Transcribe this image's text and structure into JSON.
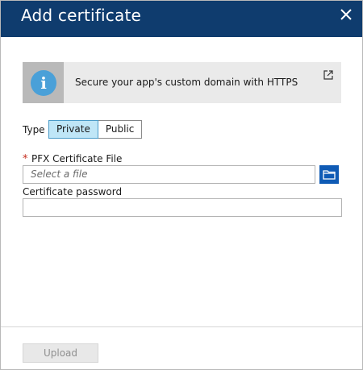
{
  "dialog": {
    "title": "Add certificate",
    "close_icon": "close-icon"
  },
  "banner": {
    "icon": "info-icon",
    "icon_glyph": "i",
    "message": "Secure your app's custom domain with HTTPS",
    "link_icon": "external-link-icon"
  },
  "type_selector": {
    "label": "Type",
    "options": [
      "Private",
      "Public"
    ],
    "selected": "Private"
  },
  "pfx_field": {
    "required_marker": "*",
    "label": "PFX Certificate File",
    "placeholder": "Select a file",
    "browse_icon": "folder-icon"
  },
  "password_field": {
    "label": "Certificate password",
    "value": ""
  },
  "footer": {
    "upload_label": "Upload",
    "upload_enabled": false
  },
  "colors": {
    "header": "#0f3c6e",
    "info_icon": "#4aa0d8",
    "selected_option": "#bfe6f7",
    "browse_button": "#0f5bb5",
    "required": "#c42b1c"
  }
}
